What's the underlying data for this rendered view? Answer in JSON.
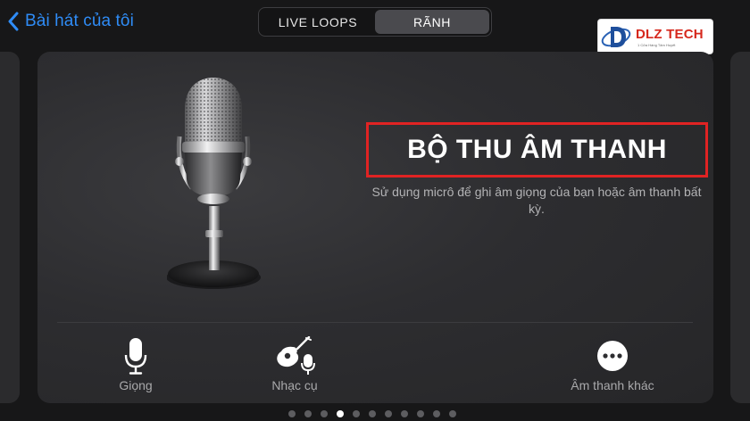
{
  "nav": {
    "back_label": "Bài hát của tôi"
  },
  "segmented": {
    "tabs": [
      {
        "label": "LIVE LOOPS",
        "active": false
      },
      {
        "label": "RÃNH",
        "active": true
      }
    ]
  },
  "brand": {
    "name": "DLZ TECH",
    "tagline": "1 Cửa Hàng Tâm Huyết",
    "accent": "#d6281d"
  },
  "card": {
    "title": "BỘ THU ÂM THANH",
    "description": "Sử dụng micrô để ghi âm giọng của bạn hoặc âm thanh bất kỳ.",
    "highlight_color": "#e02323",
    "options": [
      {
        "label": "Giọng",
        "icon": "microphone-icon"
      },
      {
        "label": "Nhạc cụ",
        "icon": "guitar-mic-icon"
      },
      {
        "label": "Âm thanh khác",
        "icon": "more-icon"
      }
    ]
  },
  "pager": {
    "count": 11,
    "active_index": 3
  },
  "colors": {
    "background": "#171718",
    "link": "#2f8cf6"
  }
}
